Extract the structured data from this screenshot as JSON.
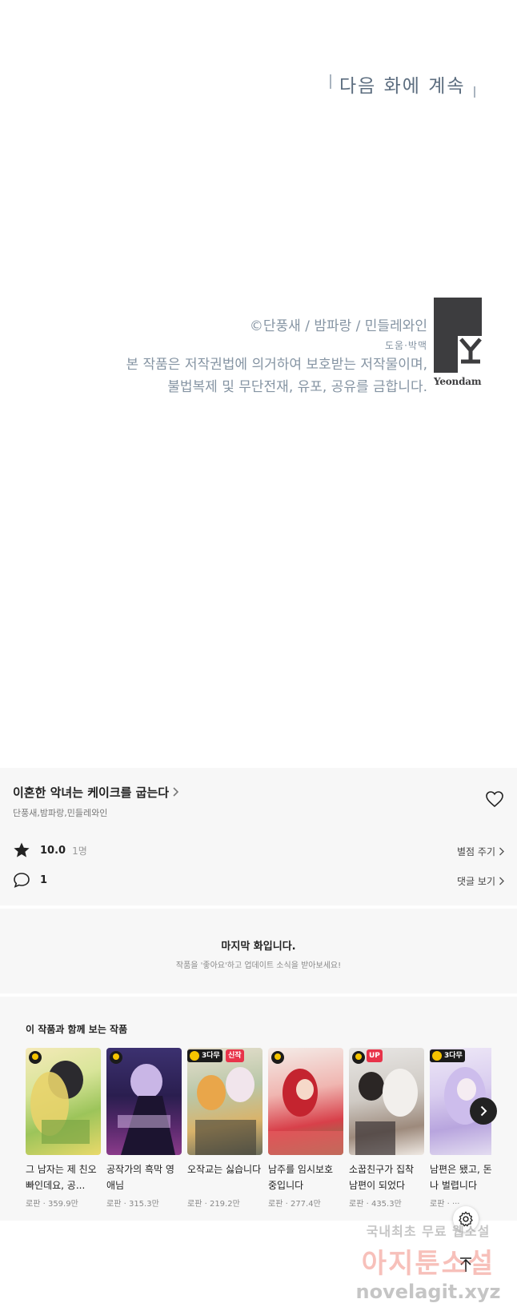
{
  "comic": {
    "next_episode": "다음 화에 계속",
    "credit_line1": "©단풍새 / 밤파랑 / 민들레와인",
    "credit_line2": "도움·박맥",
    "credit_line3": "본 작품은 저작권법에 의거하여 보호받는 저작물이며,",
    "credit_line4": "불법복제 및 무단전재, 유포, 공유를 금합니다.",
    "logo_text": "Yeondam"
  },
  "series": {
    "title": "이혼한 악녀는 케이크를 굽는다",
    "authors": "단풍새,밤파랑,민들레와인",
    "rating": "10.0",
    "rating_count": "1명",
    "rate_link": "별점 주기",
    "comments": "1",
    "comments_link": "댓글 보기"
  },
  "notice": {
    "title": "마지막 화입니다.",
    "subtitle": "작품을 '좋아요'하고 업데이트 소식을 받아보세요!"
  },
  "recommendations": {
    "heading": "이 작품과 함께 보는 작품",
    "items": [
      {
        "title": "그 남자는 제 친오빠인데요, 공...",
        "genre": "로판",
        "views": "359.9만",
        "badge": "wait"
      },
      {
        "title": "공작가의 흑막 영애님",
        "genre": "로판",
        "views": "315.3만",
        "badge": "wait"
      },
      {
        "title": "오작교는 싫습니다",
        "genre": "로판",
        "views": "219.2만",
        "badge": "3다무",
        "badge2": "신작"
      },
      {
        "title": "남주를 임시보호 중입니다",
        "genre": "로판",
        "views": "277.4만",
        "badge": "wait"
      },
      {
        "title": "소꿉친구가 집착 남편이 되었다",
        "genre": "로판",
        "views": "435.3만",
        "badge": "wait",
        "badge2": "UP"
      },
      {
        "title": "남편은 됐고, 돈이나 벌렵니다",
        "genre": "로판",
        "views": "···",
        "badge": "3다무"
      }
    ]
  },
  "watermark": {
    "line1": "국내최초 무료 웹소설",
    "line2": "아지툰소설",
    "line3": "novelagit.xyz"
  },
  "colors": {
    "panel_bg": "#f7f7f7",
    "credit_text": "#8594a3",
    "badge_new": "#e8334a",
    "badge_wait": "#f5c400"
  }
}
